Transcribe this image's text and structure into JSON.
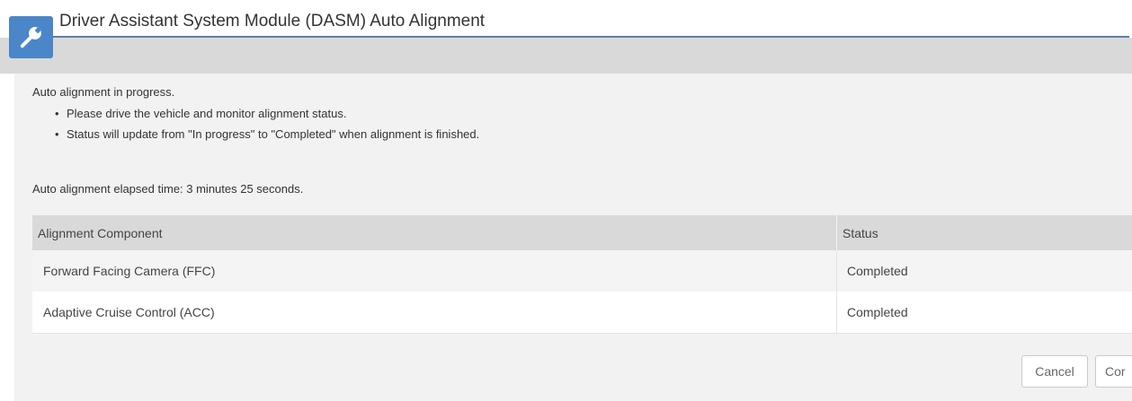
{
  "window": {
    "title": "Driver Assistant System Module (DASM) Auto Alignment",
    "icon": "wrench-icon"
  },
  "instructions": {
    "intro": "Auto alignment in progress.",
    "bullets": [
      "Please drive the vehicle and monitor alignment status.",
      "Status will update from \"In progress\" to \"Completed\" when alignment is finished."
    ],
    "elapsed": "Auto alignment elapsed time: 3 minutes 25 seconds."
  },
  "table": {
    "headers": {
      "component": "Alignment Component",
      "status": "Status"
    },
    "rows": [
      {
        "component": "Forward Facing Camera (FFC)",
        "status": "Completed"
      },
      {
        "component": "Adaptive Cruise Control (ACC)",
        "status": "Completed"
      }
    ]
  },
  "footer": {
    "cancel_label": "Cancel",
    "continue_label": "Cor"
  },
  "colors": {
    "accent": "#4a86c8",
    "title_underline": "#5f7ea6",
    "header_band": "#d9d9d9",
    "content_bg": "#f2f2f2"
  }
}
